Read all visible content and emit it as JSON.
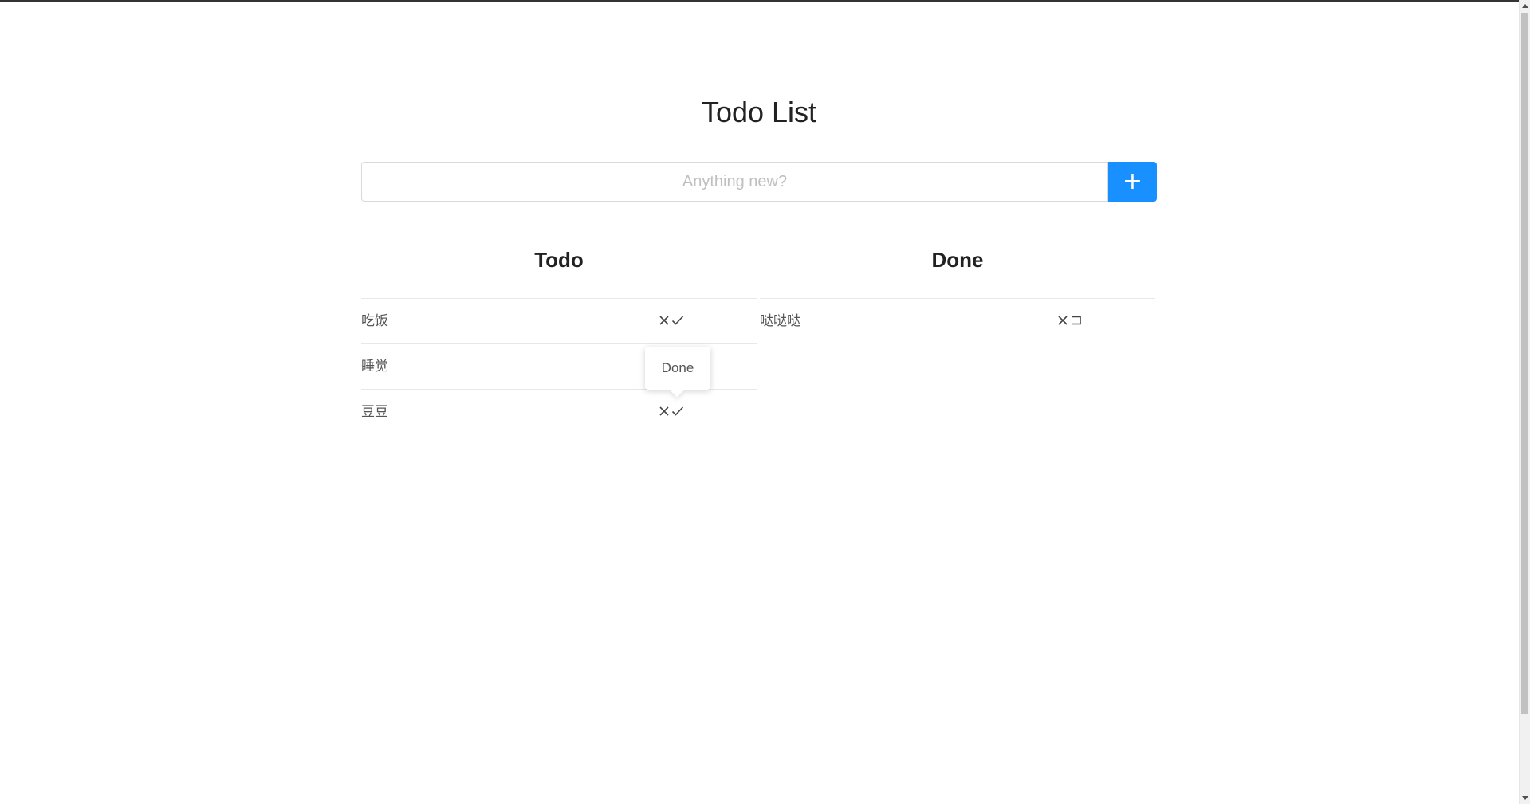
{
  "app": {
    "title": "Todo List"
  },
  "new_item": {
    "placeholder": "Anything new?",
    "value": "",
    "add_icon": "plus-icon"
  },
  "todo": {
    "heading": "Todo",
    "items": [
      {
        "text": "吃饭",
        "delete_icon": "close-icon",
        "complete_icon": "check-icon"
      },
      {
        "text": "睡觉",
        "delete_icon": "close-icon",
        "complete_icon": "check-icon"
      },
      {
        "text": "豆豆",
        "delete_icon": "close-icon",
        "complete_icon": "check-icon"
      }
    ]
  },
  "done": {
    "heading": "Done",
    "items": [
      {
        "text": "哒哒哒",
        "delete_icon": "close-icon",
        "undo_icon": "undo-icon"
      }
    ]
  },
  "tooltip": {
    "text": "Done"
  },
  "colors": {
    "accent": "#1890ff",
    "divider": "#e8e8e8"
  }
}
